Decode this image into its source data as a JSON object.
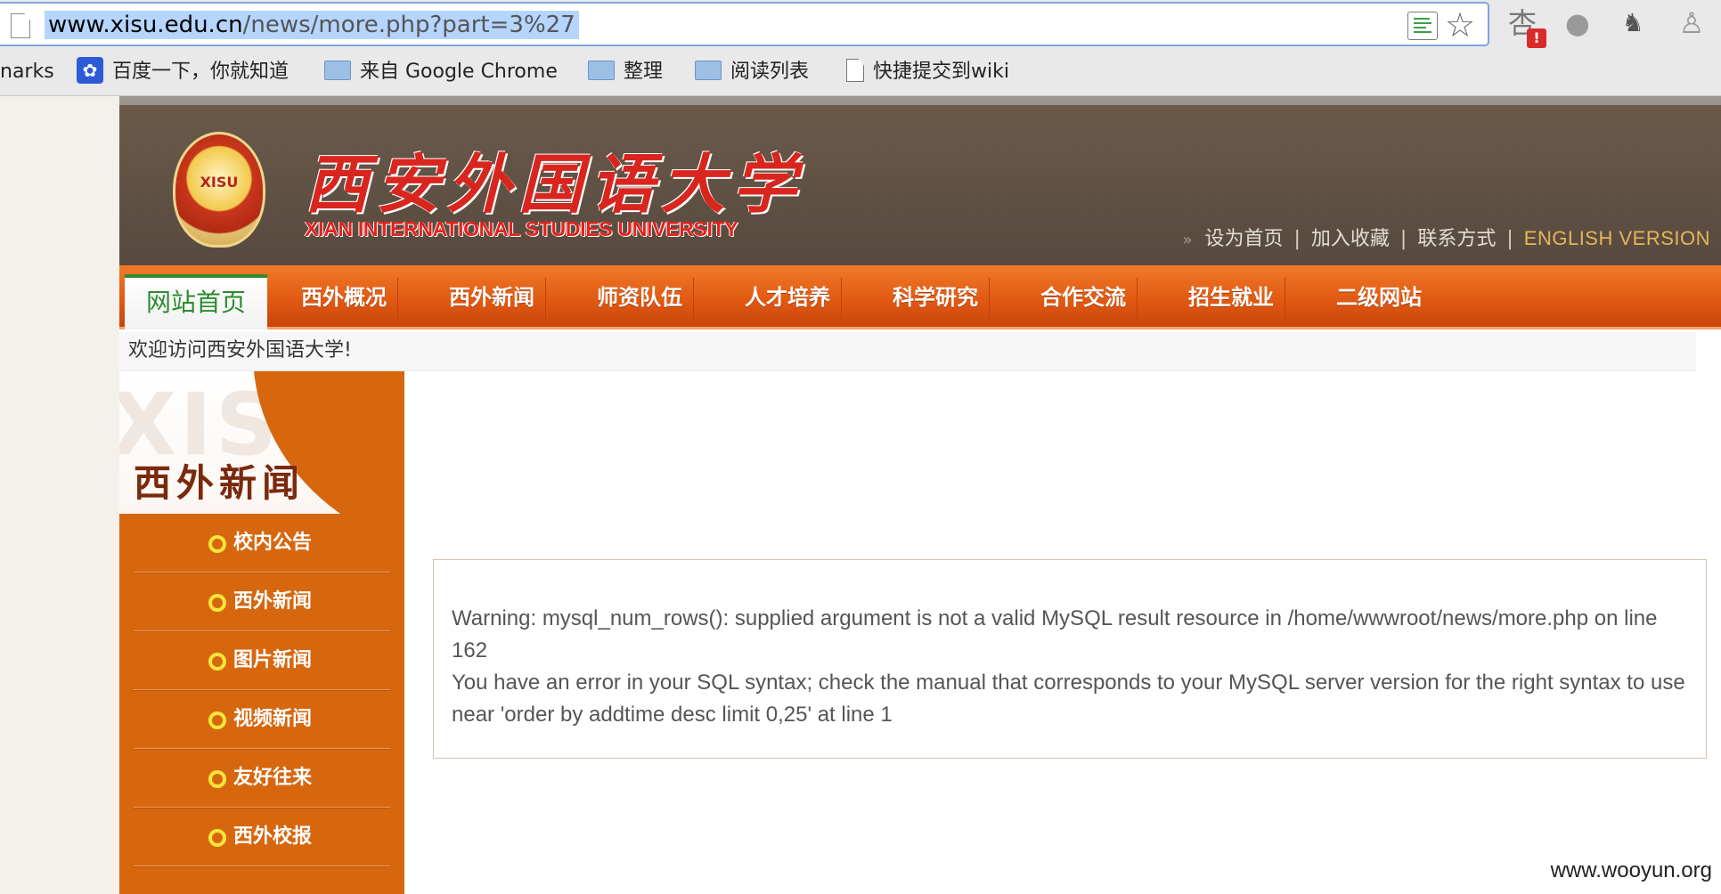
{
  "browser": {
    "url_host": "www.xisu.edu.cn",
    "url_path": "/news/more.php?part=3%27",
    "icons": [
      "page-icon",
      "reader-mode-icon",
      "star-icon",
      "extension-icon-1",
      "globe-icon",
      "evernote-icon",
      "shield-icon"
    ],
    "ext_badge": "!"
  },
  "bookmarks": [
    {
      "label": "narks",
      "icon": "none"
    },
    {
      "label": "百度一下，你就知道",
      "icon": "baidu-paw-icon"
    },
    {
      "label": "来自 Google Chrome",
      "icon": "folder-icon"
    },
    {
      "label": "整理",
      "icon": "folder-icon"
    },
    {
      "label": "阅读列表",
      "icon": "folder-icon"
    },
    {
      "label": "快捷提交到wiki",
      "icon": "document-icon"
    }
  ],
  "site": {
    "logo_text": "XISU",
    "name_cn": "西安外国语大学",
    "name_en": "XIAN INTERNATIONAL STUDIES UNIVERSITY",
    "top_links": [
      "设为首页",
      "加入收藏",
      "联系方式",
      "ENGLISH VERSION"
    ],
    "top_links_prefix": "»",
    "nav": [
      "网站首页",
      "西外概况",
      "西外新闻",
      "师资队伍",
      "人才培养",
      "科学研究",
      "合作交流",
      "招生就业",
      "二级网站"
    ],
    "welcome": "欢迎访问西安外国语大学!",
    "sidebar": {
      "watermark": "XISU",
      "title": "西外新闻",
      "items": [
        "校内公告",
        "西外新闻",
        "图片新闻",
        "视频新闻",
        "友好往来",
        "西外校报"
      ]
    },
    "errors": [
      "Warning: mysql_num_rows(): supplied argument is not a valid MySQL result resource in /home/wwwroot/news/more.php on line 162",
      "You have an error in your SQL syntax; check the manual that corresponds to your MySQL server version for the right syntax to use near 'order by addtime desc limit 0,25' at line 1"
    ]
  },
  "watermark": "www.wooyun.org",
  "colors": {
    "header_brown": "#5e5043",
    "nav_orange": "#e25a12",
    "sidebar_orange": "#d7670f",
    "accent_red": "#d8261f",
    "home_green": "#2d8b2f"
  }
}
